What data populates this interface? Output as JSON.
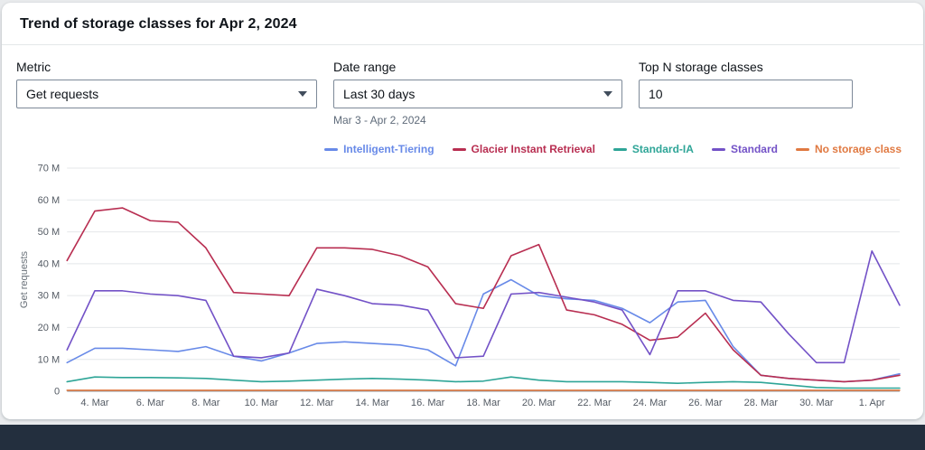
{
  "header": {
    "title": "Trend of storage classes for Apr 2, 2024"
  },
  "controls": {
    "metric": {
      "label": "Metric",
      "value": "Get requests"
    },
    "date_range": {
      "label": "Date range",
      "value": "Last 30 days",
      "helper": "Mar 3 - Apr 2, 2024"
    },
    "top_n": {
      "label": "Top N storage classes",
      "value": "10"
    }
  },
  "chart_data": {
    "type": "line",
    "title": "Trend of storage classes for Apr 2, 2024",
    "xlabel": "",
    "ylabel": "Get requests",
    "unit": "millions of requests",
    "ylim_millions": [
      0,
      70
    ],
    "y_tick_labels": [
      "0",
      "10 M",
      "20 M",
      "30 M",
      "40 M",
      "50 M",
      "60 M",
      "70 M"
    ],
    "grid": "horizontal",
    "legend_position": "top-right",
    "categories": [
      "Mar 3",
      "Mar 4",
      "Mar 5",
      "Mar 6",
      "Mar 7",
      "Mar 8",
      "Mar 9",
      "Mar 10",
      "Mar 11",
      "Mar 12",
      "Mar 13",
      "Mar 14",
      "Mar 15",
      "Mar 16",
      "Mar 17",
      "Mar 18",
      "Mar 19",
      "Mar 20",
      "Mar 21",
      "Mar 22",
      "Mar 23",
      "Mar 24",
      "Mar 25",
      "Mar 26",
      "Mar 27",
      "Mar 28",
      "Mar 29",
      "Mar 30",
      "Mar 31",
      "Apr 1",
      "Apr 2"
    ],
    "x_tick_labels": [
      "4. Mar",
      "6. Mar",
      "8. Mar",
      "10. Mar",
      "12. Mar",
      "14. Mar",
      "16. Mar",
      "18. Mar",
      "20. Mar",
      "22. Mar",
      "24. Mar",
      "26. Mar",
      "28. Mar",
      "30. Mar",
      "1. Apr"
    ],
    "series": [
      {
        "name": "Intelligent-Tiering",
        "color": "#688ae8",
        "values": [
          9,
          13.5,
          13.5,
          13,
          12.5,
          14,
          11,
          9.5,
          12,
          15,
          15.5,
          15,
          14.5,
          13,
          8,
          30.5,
          35,
          30,
          29,
          28.5,
          26,
          21.5,
          28,
          28.5,
          14,
          5,
          4,
          3.5,
          3,
          3.5,
          5.5
        ]
      },
      {
        "name": "Glacier Instant Retrieval",
        "color": "#b82e51",
        "values": [
          41,
          56.5,
          57.5,
          53.5,
          53,
          45,
          31,
          30.5,
          30,
          45,
          45,
          44.5,
          42.5,
          39,
          27.5,
          26,
          42.5,
          46,
          25.5,
          24,
          21,
          16,
          17,
          24.5,
          13,
          5,
          4,
          3.5,
          3,
          3.5,
          5
        ]
      },
      {
        "name": "Standard-IA",
        "color": "#2ea597",
        "values": [
          3,
          4.5,
          4.3,
          4.3,
          4.2,
          4,
          3.5,
          3,
          3.2,
          3.5,
          3.8,
          4,
          3.8,
          3.5,
          3,
          3.2,
          4.5,
          3.5,
          3,
          3,
          3,
          2.8,
          2.5,
          2.8,
          3,
          2.8,
          2,
          1.2,
          1,
          1,
          1
        ]
      },
      {
        "name": "Standard",
        "color": "#7352c7",
        "values": [
          13,
          31.5,
          31.5,
          30.5,
          30,
          28.5,
          11,
          10.5,
          12,
          32,
          30,
          27.5,
          27,
          25.5,
          10.5,
          11,
          30.5,
          31,
          29.5,
          28,
          25.5,
          11.5,
          31.5,
          31.5,
          28.5,
          28,
          18,
          9,
          9,
          44,
          27
        ]
      },
      {
        "name": "No storage class",
        "color": "#e07941",
        "values": [
          0.3,
          0.3,
          0.3,
          0.3,
          0.3,
          0.3,
          0.3,
          0.3,
          0.3,
          0.3,
          0.3,
          0.3,
          0.3,
          0.3,
          0.3,
          0.3,
          0.3,
          0.3,
          0.3,
          0.3,
          0.3,
          0.3,
          0.3,
          0.3,
          0.3,
          0.3,
          0.3,
          0.3,
          0.3,
          0.3,
          0.3
        ]
      }
    ]
  }
}
